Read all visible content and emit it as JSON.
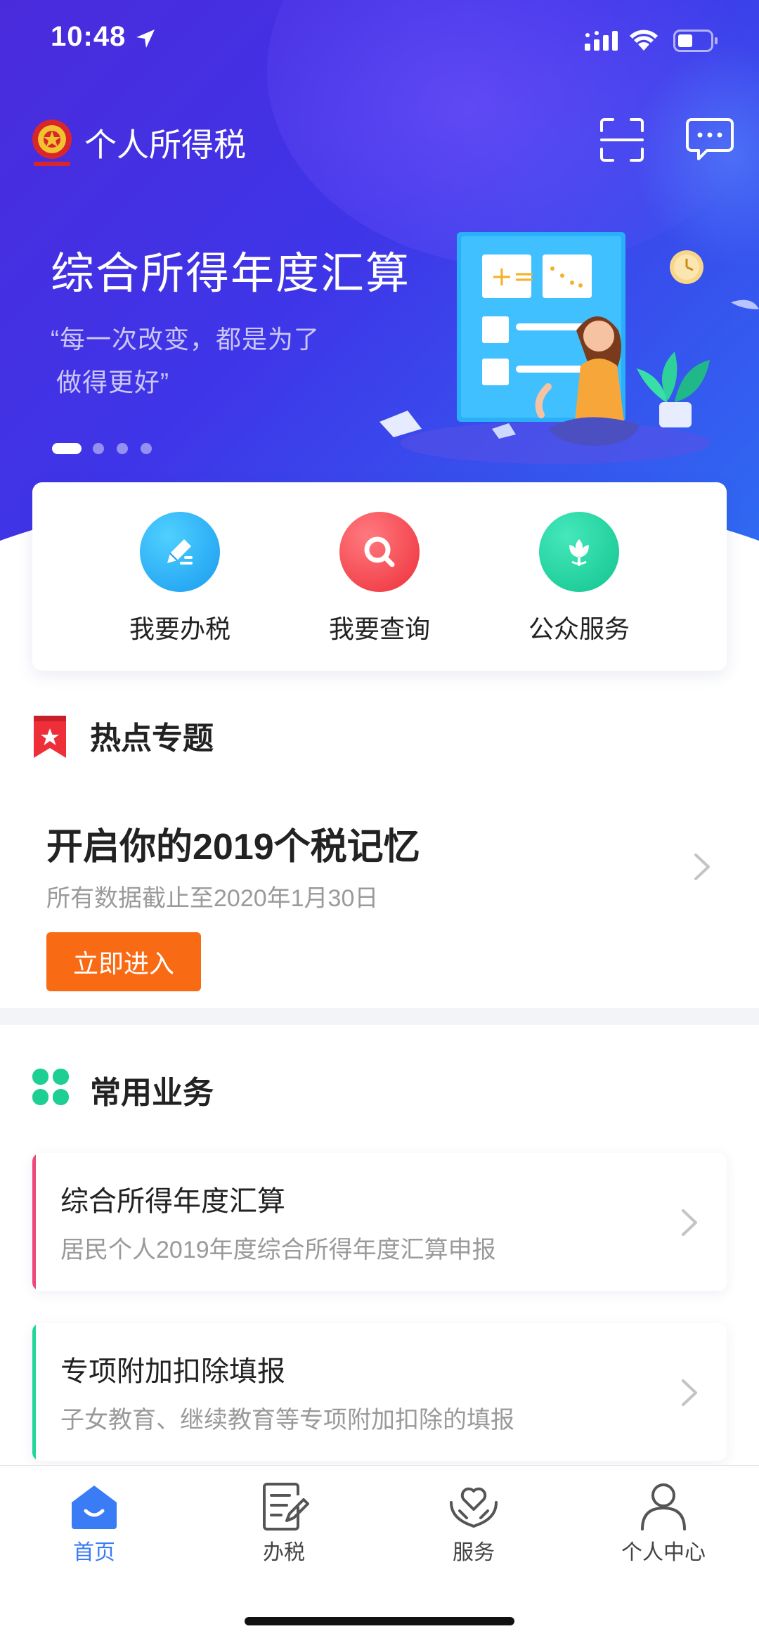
{
  "status_bar": {
    "time": "10:48"
  },
  "header": {
    "app_title": "个人所得税"
  },
  "banner": {
    "title": "综合所得年度汇算",
    "quote_line1": "“每一次改变，都是为了",
    "quote_line2": "做得更好”",
    "slide_count": 4,
    "active_slide": 1
  },
  "quick_actions": [
    {
      "label": "我要办税",
      "icon": "pencil-icon",
      "color": "#1fa8f5"
    },
    {
      "label": "我要查询",
      "icon": "search-icon",
      "color": "#f2434a"
    },
    {
      "label": "公众服务",
      "icon": "lotus-icon",
      "color": "#1dd1a1"
    }
  ],
  "hot_topics": {
    "section_title": "热点专题",
    "card_title": "开启你的2019个税记忆",
    "card_subtitle": "所有数据截止至2020年1月30日",
    "button_label": "立即进入"
  },
  "common_services": {
    "section_title": "常用业务",
    "items": [
      {
        "title": "综合所得年度汇算",
        "subtitle": "居民个人2019年度综合所得年度汇算申报",
        "accent": "#f0467a"
      },
      {
        "title": "专项附加扣除填报",
        "subtitle": "子女教育、继续教育等专项附加扣除的填报",
        "accent": "#21d79a"
      }
    ]
  },
  "tab_bar": {
    "tabs": [
      {
        "label": "首页",
        "icon": "home-icon",
        "active": true
      },
      {
        "label": "办税",
        "icon": "document-edit-icon",
        "active": false
      },
      {
        "label": "服务",
        "icon": "heart-hands-icon",
        "active": false
      },
      {
        "label": "个人中心",
        "icon": "user-icon",
        "active": false
      }
    ]
  },
  "colors": {
    "brand_blue": "#3a7bf6",
    "hero_purple": "#4a2bdc",
    "cta_orange": "#f96a14"
  }
}
